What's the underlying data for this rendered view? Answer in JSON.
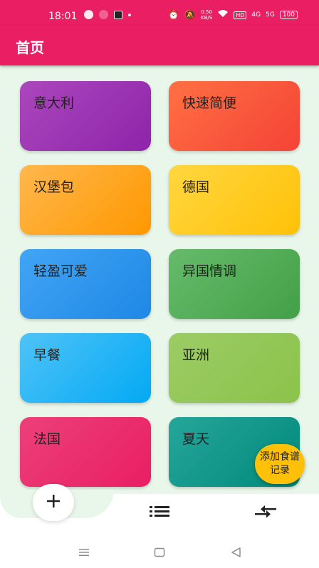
{
  "status_bar": {
    "time": "18:01",
    "net_speed_value": "0.50",
    "net_speed_unit": "KB/S",
    "hd_badge": "HD",
    "signal_1": "4G",
    "signal_2": "5G",
    "battery": "100"
  },
  "app_bar": {
    "title": "首页"
  },
  "cards": [
    {
      "label": "意大利",
      "color_from": "#ab47bc",
      "color_to": "#8e24aa"
    },
    {
      "label": "快速简便",
      "color_from": "#ff7043",
      "color_to": "#f44336"
    },
    {
      "label": "汉堡包",
      "color_from": "#ffb74d",
      "color_to": "#ff9800"
    },
    {
      "label": "德国",
      "color_from": "#ffd740",
      "color_to": "#ffc107"
    },
    {
      "label": "轻盈可爱",
      "color_from": "#42a5f5",
      "color_to": "#1e88e5"
    },
    {
      "label": "异国情调",
      "color_from": "#66bb6a",
      "color_to": "#43a047"
    },
    {
      "label": "早餐",
      "color_from": "#4fc3f7",
      "color_to": "#03a9f4"
    },
    {
      "label": "亚洲",
      "color_from": "#9ccc65",
      "color_to": "#8bc34a"
    },
    {
      "label": "法国",
      "color_from": "#ec407a",
      "color_to": "#e91e63"
    },
    {
      "label": "夏天",
      "color_from": "#26a69a",
      "color_to": "#00897b"
    }
  ],
  "fab": {
    "label": "添加食谱记录",
    "color": "#ffc107"
  },
  "bottom_nav": {
    "items": [
      {
        "name": "add",
        "icon": "plus-icon"
      },
      {
        "name": "list",
        "icon": "list-icon"
      },
      {
        "name": "compare",
        "icon": "compare-arrows-icon"
      }
    ]
  },
  "colors": {
    "primary": "#e91e63",
    "background": "#e9f7ea"
  }
}
